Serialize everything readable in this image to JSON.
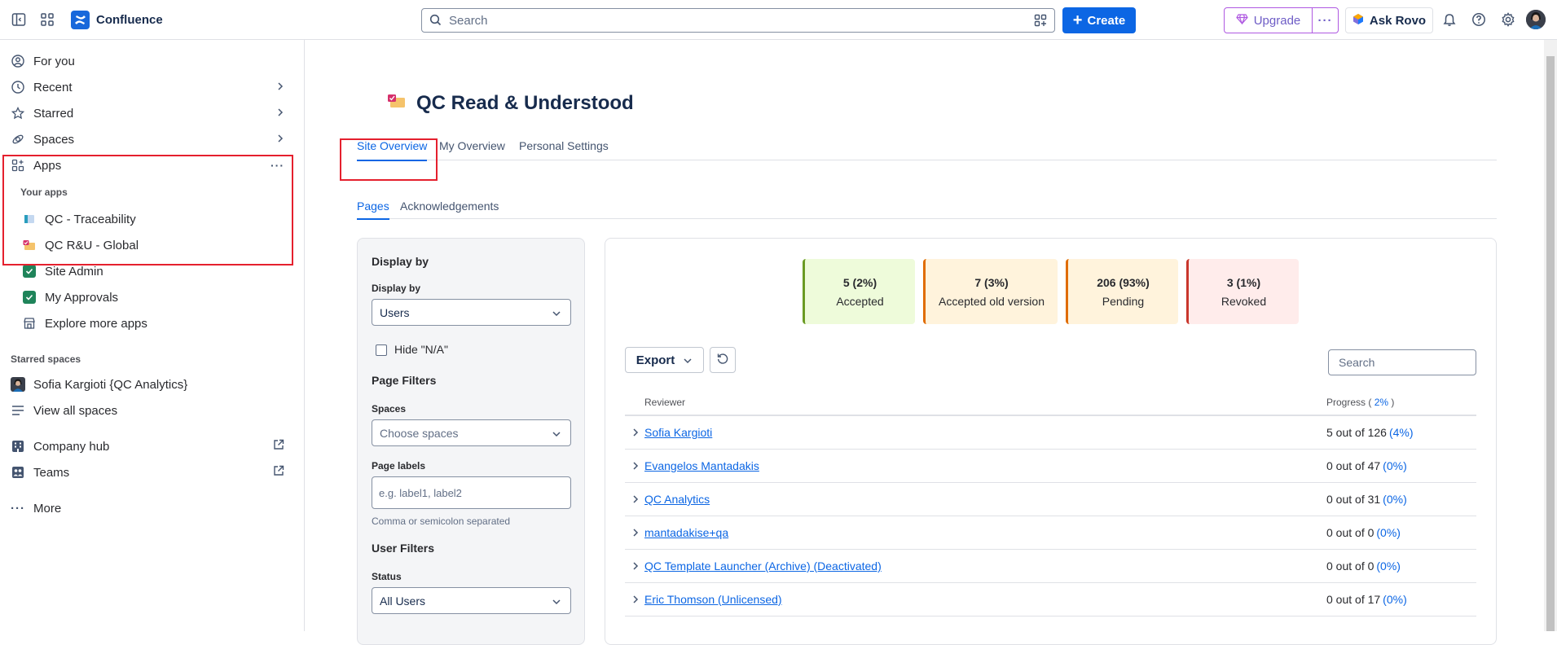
{
  "topbar": {
    "app_name": "Confluence",
    "search_placeholder": "Search",
    "create_label": "Create",
    "upgrade_label": "Upgrade",
    "rovo_label": "Ask Rovo",
    "brand_color": "#1868db",
    "icons": [
      "sidebar-toggle-icon",
      "app-switcher-icon",
      "confluence-logo-icon",
      "search-icon",
      "search-filter-icon",
      "plus-icon",
      "gem-icon",
      "more-icon",
      "rovo-icon",
      "bell-icon",
      "help-icon",
      "settings-icon",
      "avatar"
    ]
  },
  "sidebar": {
    "items": {
      "for_you": "For you",
      "recent": "Recent",
      "starred": "Starred",
      "spaces": "Spaces",
      "apps": "Apps"
    },
    "your_apps_label": "Your apps",
    "apps": [
      "QC - Traceability",
      "QC R&U - Global",
      "Site Admin",
      "My Approvals",
      "Explore more apps"
    ],
    "starred_spaces_label": "Starred spaces",
    "starred_space": "Sofia Kargioti {QC Analytics}",
    "view_all_spaces": "View all spaces",
    "company_hub": "Company hub",
    "teams": "Teams",
    "more": "More"
  },
  "page": {
    "title": "QC Read & Understood",
    "tabs": [
      "Site Overview",
      "My Overview",
      "Personal Settings"
    ],
    "subtabs": [
      "Pages",
      "Acknowledgements"
    ]
  },
  "filters": {
    "display_by_heading": "Display by",
    "display_by_label": "Display by",
    "display_by_value": "Users",
    "hide_na_label": "Hide \"N/A\"",
    "hide_na_checked": false,
    "page_filters_heading": "Page Filters",
    "spaces_label": "Spaces",
    "spaces_placeholder": "Choose spaces",
    "page_labels_label": "Page labels",
    "page_labels_placeholder": "e.g. label1, label2",
    "page_labels_help": "Comma or semicolon separated",
    "user_filters_heading": "User Filters",
    "status_label": "Status",
    "status_value": "All Users"
  },
  "stats": [
    {
      "count": "5 (2%)",
      "label": "Accepted",
      "bg": "#eefbda",
      "border": "#6a9a23"
    },
    {
      "count": "7 (3%)",
      "label": "Accepted old version",
      "bg": "#fff3dc",
      "border": "#e06c00"
    },
    {
      "count": "206 (93%)",
      "label": "Pending",
      "bg": "#fff3dc",
      "border": "#e06c00"
    },
    {
      "count": "3 (1%)",
      "label": "Revoked",
      "bg": "#ffeceb",
      "border": "#c9372c"
    }
  ],
  "table": {
    "export_label": "Export",
    "search_placeholder": "Search",
    "col_reviewer": "Reviewer",
    "col_progress": "Progress (",
    "col_progress_pct": "2%",
    "col_progress_close": ")",
    "rows": [
      {
        "name": "Sofia Kargioti",
        "progress": "5 out of 126",
        "pct": "(4%)"
      },
      {
        "name": "Evangelos Mantadakis",
        "progress": "0 out of 47",
        "pct": "(0%)"
      },
      {
        "name": "QC Analytics",
        "progress": "0 out of 31",
        "pct": "(0%)"
      },
      {
        "name": "mantadakise+qa",
        "progress": "0 out of 0",
        "pct": "(0%)"
      },
      {
        "name": "QC Template Launcher (Archive) (Deactivated)",
        "progress": "0 out of 0",
        "pct": "(0%)"
      },
      {
        "name": "Eric Thomson (Unlicensed)",
        "progress": "0 out of 17",
        "pct": "(0%)"
      }
    ]
  },
  "annotations": {
    "highlight_color": "#e5202e"
  }
}
